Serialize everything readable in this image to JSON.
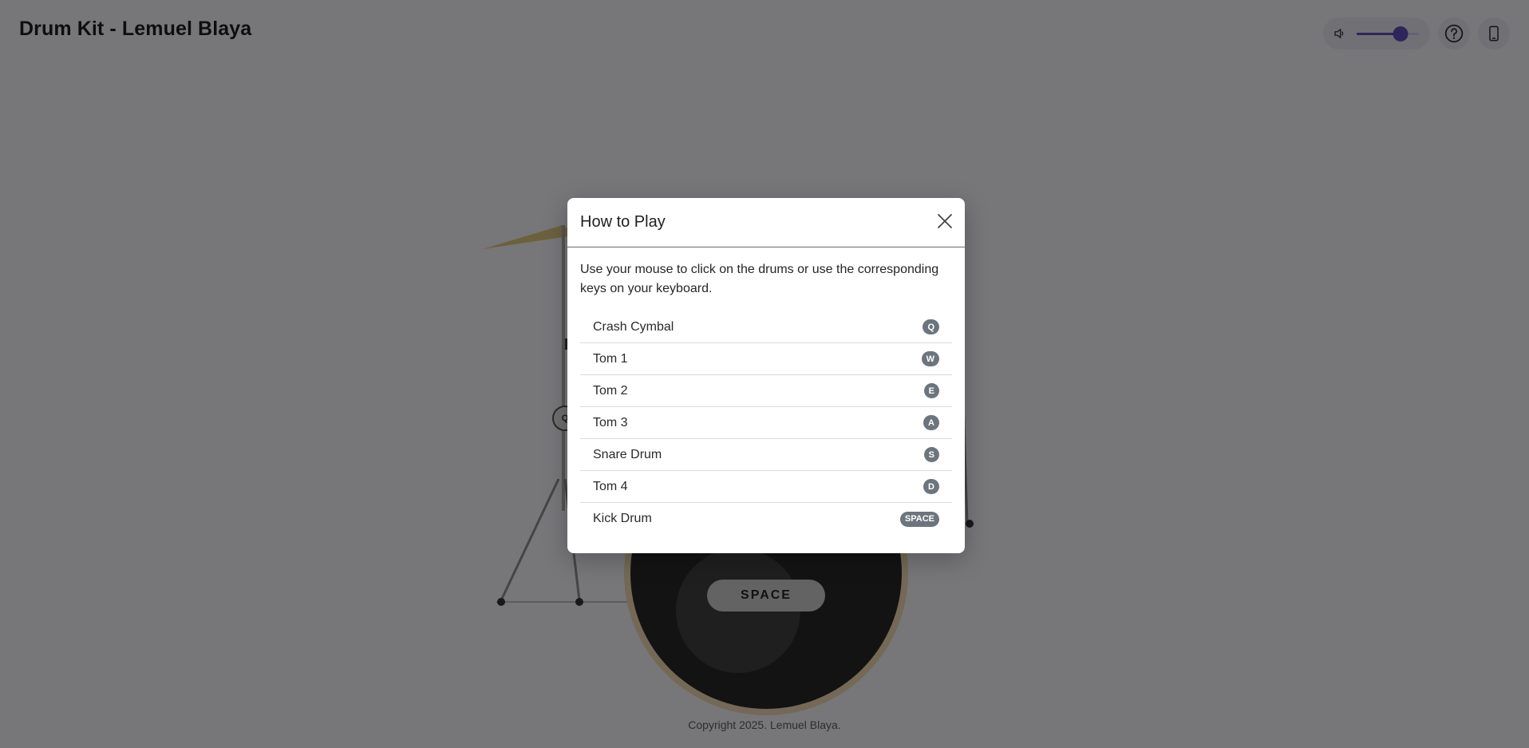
{
  "app": {
    "title": "Drum Kit - Lemuel Blaya"
  },
  "controls": {
    "volume_icon": "volume-down-icon",
    "volume_level": 0.7,
    "help_icon": "help-circle-icon",
    "device_icon": "mobile-device-icon"
  },
  "kit": {
    "space_key": "SPACE",
    "side_key": "Q"
  },
  "dialog": {
    "title": "How to Play",
    "close_icon": "close-icon",
    "description": "Use your mouse to click on the drums or use the corresponding keys on your keyboard.",
    "items": [
      {
        "label": "Crash Cymbal",
        "key": "Q"
      },
      {
        "label": "Tom 1",
        "key": "W"
      },
      {
        "label": "Tom 2",
        "key": "E"
      },
      {
        "label": "Tom 3",
        "key": "A"
      },
      {
        "label": "Snare Drum",
        "key": "S"
      },
      {
        "label": "Tom 4",
        "key": "D"
      },
      {
        "label": "Kick Drum",
        "key": "SPACE"
      }
    ]
  },
  "footer": {
    "copyright": "Copyright 2025. Lemuel Blaya."
  },
  "colors": {
    "accent": "#5c4ab5",
    "badge": "#6c757d",
    "scrim": "rgba(0,0,0,0.5)"
  }
}
